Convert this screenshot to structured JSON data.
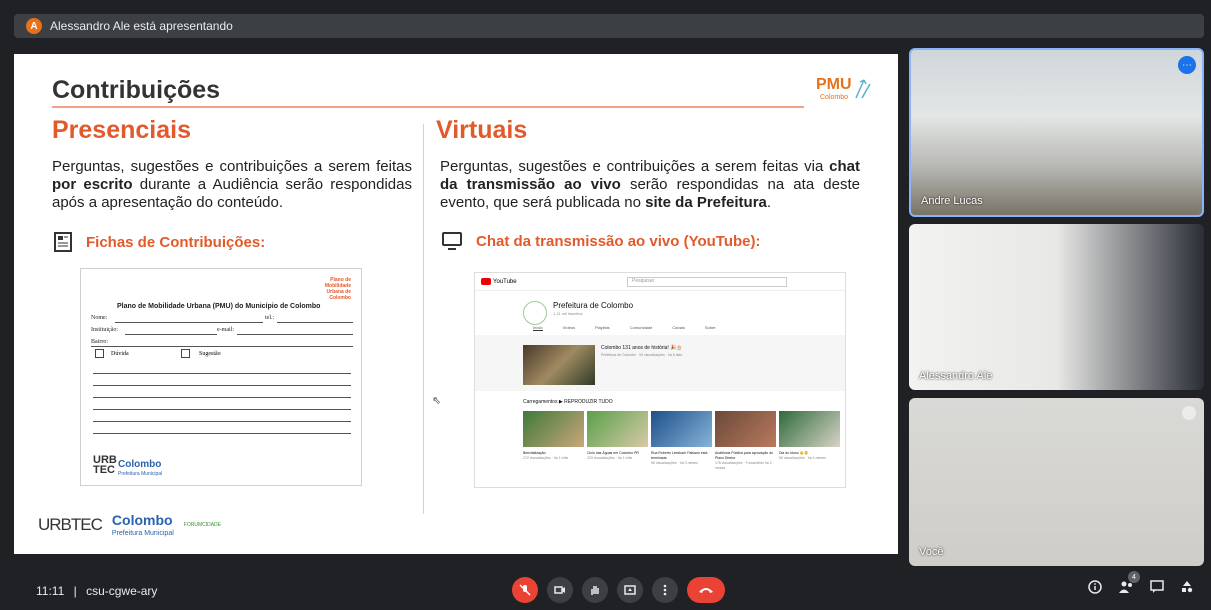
{
  "presenter_bar": {
    "avatar_letter": "A",
    "text": "Alessandro Ale está apresentando"
  },
  "slide": {
    "title": "Contribuições",
    "logo": {
      "brand": "PMU",
      "sub": "Colombo"
    },
    "left": {
      "heading": "Presenciais",
      "body_1": "Perguntas, sugestões e contribuições a serem feitas ",
      "body_bold": "por escrito",
      "body_2": " durante a Audiência serão respondidas após a apresentação do conteúdo.",
      "subheading": "Fichas de Contribuições:",
      "form": {
        "logo_text": "Plano de Mobilidade Urbana de Colombo",
        "title": "Plano de Mobilidade Urbana (PMU) do Município de Colombo",
        "nome": "Nome:",
        "tel": "tel.:",
        "instituicao": "Instituição:",
        "email": "e-mail:",
        "bairro": "Bairro:",
        "duvida": "Dúvida",
        "sugestao": "Sugestão",
        "urb": "URB",
        "tec": "TEC",
        "colombo": "Colombo",
        "prefeitura": "Prefeitura Municipal"
      }
    },
    "right": {
      "heading": "Virtuais",
      "body_1": "Perguntas, sugestões e contribuições a serem feitas via ",
      "body_bold_1": "chat da transmissão ao vivo",
      "body_2": " serão respondidas na ata deste evento, que será publicada no ",
      "body_bold_2": "site da Prefeitura",
      "body_3": ".",
      "subheading": "Chat da transmissão ao vivo (YouTube):",
      "youtube": {
        "logo": "YouTube",
        "search_placeholder": "Pesquisar",
        "channel_name": "Prefeitura de Colombo",
        "subscribers": "1,11 mil inscritos",
        "tabs": [
          "Início",
          "Vídeos",
          "Playlists",
          "Comunidade",
          "Canais",
          "Sobre"
        ],
        "featured_title": "Colombo 131 anos de história! 🎉🎂",
        "featured_meta": "Prefeitura de Colombo · 90 visualizações · há 5 dias",
        "shelf": "Carregamentos   ▶ REPRODUZIR TUDO",
        "videos": [
          {
            "title": "Benvitalização",
            "meta": "272 visualizações · há 1 mês"
          },
          {
            "title": "Ciclo das Águas em Colombo PR",
            "meta": "333 visualizações · há 1 mês"
          },
          {
            "title": "Rua Roberto Lamboch Fabiano está terminada",
            "meta": "56 visualizações · há 3 meses"
          },
          {
            "title": "Audiência Pública para aprovação do Plano Diretor",
            "meta": "176 visualizações · Transmitido há 3 meses"
          },
          {
            "title": "Dia do Idoso 👴👵",
            "meta": "56 visualizações · há 4 meses"
          }
        ]
      }
    },
    "footer": {
      "urbtec": "URBTEC",
      "colombo": "Colombo",
      "prefeitura": "Prefeitura Municipal",
      "forum": "FORUMCIDADE"
    }
  },
  "participants": [
    {
      "name": "Andre Lucas"
    },
    {
      "name": "Alessandro Ale"
    },
    {
      "name": "Você"
    }
  ],
  "bottom": {
    "time": "11:11",
    "separator": "|",
    "meeting_code": "csu-cgwe-ary",
    "participants_count": "4"
  }
}
